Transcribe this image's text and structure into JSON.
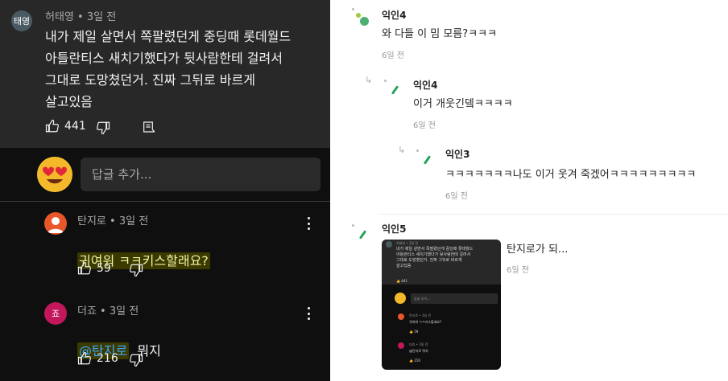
{
  "left": {
    "top_comment": {
      "avatar_text": "태영",
      "author": "허태영",
      "time": "3일 전",
      "body": "내가 제일 살면서 쪽팔렸던게 중딩때 롯데월드\n아틀란티스 새치기했다가 뒷사람한테 걸려서\n그대로 도망쳤던거. 진짜 그뒤로 바르게\n살고있음",
      "likes": "441"
    },
    "reply_input": {
      "placeholder": "답글 추가..."
    },
    "replies": [
      {
        "author": "탄지로",
        "time": "3일 전",
        "body": "귀여워 ㅋㅋ키스할래요?",
        "likes": "59"
      },
      {
        "author": "더죠",
        "avatar_text": "죠",
        "time": "3일 전",
        "mention": "@탄지로",
        "body": "뭐지",
        "likes": "216"
      }
    ]
  },
  "right": {
    "comments": [
      {
        "name": "익인4",
        "text": "와 다들 이 밈 모름?ㅋㅋㅋ",
        "time": "6일 전"
      },
      {
        "name": "익인4",
        "text": "이거 개웃긴뎈ㅋㅋㅋㅋ",
        "time": "6일 전"
      },
      {
        "name": "익인3",
        "text": "ㅋㅋㅋㅋㅋㅋㅋ나도 이거 웃겨 죽겠어ㅋㅋㅋㅋㅋㅋㅋㅋㅋ",
        "time": "6일 전"
      },
      {
        "name": "익인5",
        "text": "탄지로가 되...",
        "time": "6일 전"
      }
    ],
    "thumbnail": {
      "author": "허태영 • 3일 전",
      "body": "내가 제일 살면서 쪽팔렸던게 중딩때 롯데월드\n아틀란티스 새치기했다가 뒷사람한테 걸려서\n그대로 도망쳤던거. 진짜 그뒤로 바르게\n살고있음",
      "likes": "441",
      "input": "답글 추가...",
      "reply1_author": "탄지로 • 3일 전",
      "reply1_body": "귀여워 ㅋㅋ키스할래요?",
      "reply1_likes": "59",
      "reply2_author": "더죠 • 3일 전",
      "reply2_body": "@탄지로 뭐지",
      "reply2_likes": "216"
    }
  },
  "colors": {
    "dark_bg": "#0f0f0f",
    "card_bg": "#282828",
    "mention": "#3ea6ff",
    "accent_green": "#22a25a"
  }
}
